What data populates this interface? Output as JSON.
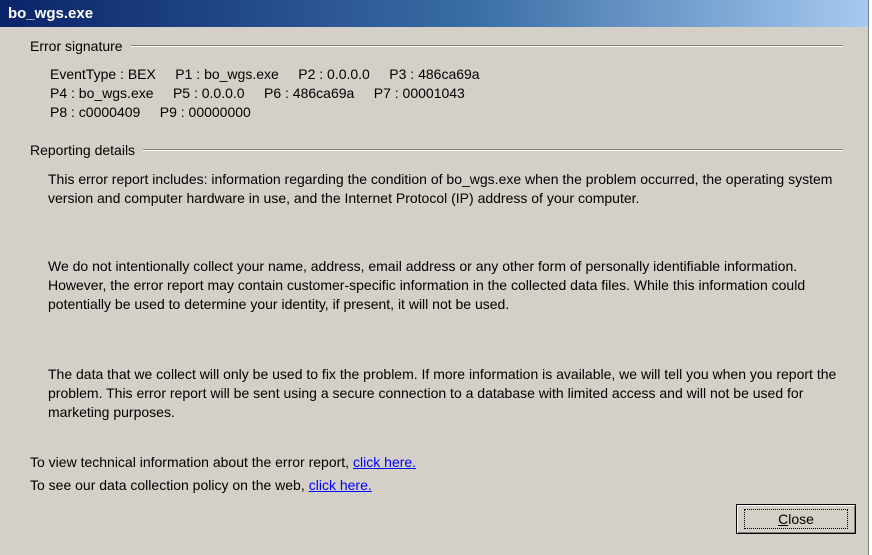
{
  "window": {
    "title": "bo_wgs.exe"
  },
  "signature": {
    "header": "Error signature",
    "lines": [
      "EventType : BEX     P1 : bo_wgs.exe     P2 : 0.0.0.0     P3 : 486ca69a",
      "P4 : bo_wgs.exe     P5 : 0.0.0.0     P6 : 486ca69a     P7 : 00001043",
      "P8 : c0000409     P9 : 00000000"
    ]
  },
  "details": {
    "header": "Reporting details",
    "paragraphs": [
      "This error report includes: information regarding the condition of bo_wgs.exe when the problem occurred, the operating system version and computer hardware in use, and the Internet Protocol (IP) address of your computer.",
      "We do not intentionally collect your name, address, email address or any other form of personally identifiable information. However, the error report may contain customer-specific information in the collected data files. While this information could potentially be used to determine your identity, if present, it will not be used.",
      "The data that we collect will only be used to fix the problem. If more information is available, we will tell you when you report the problem. This error report will be sent using a secure connection to a database with limited access and will not be used for marketing purposes."
    ]
  },
  "links": {
    "technical_text": "To view technical information about the error report,",
    "technical_link": "click here.",
    "policy_text": "To see our data collection policy on the web,",
    "policy_link": "click here."
  },
  "buttons": {
    "close_accel": "C",
    "close_rest": "lose"
  }
}
